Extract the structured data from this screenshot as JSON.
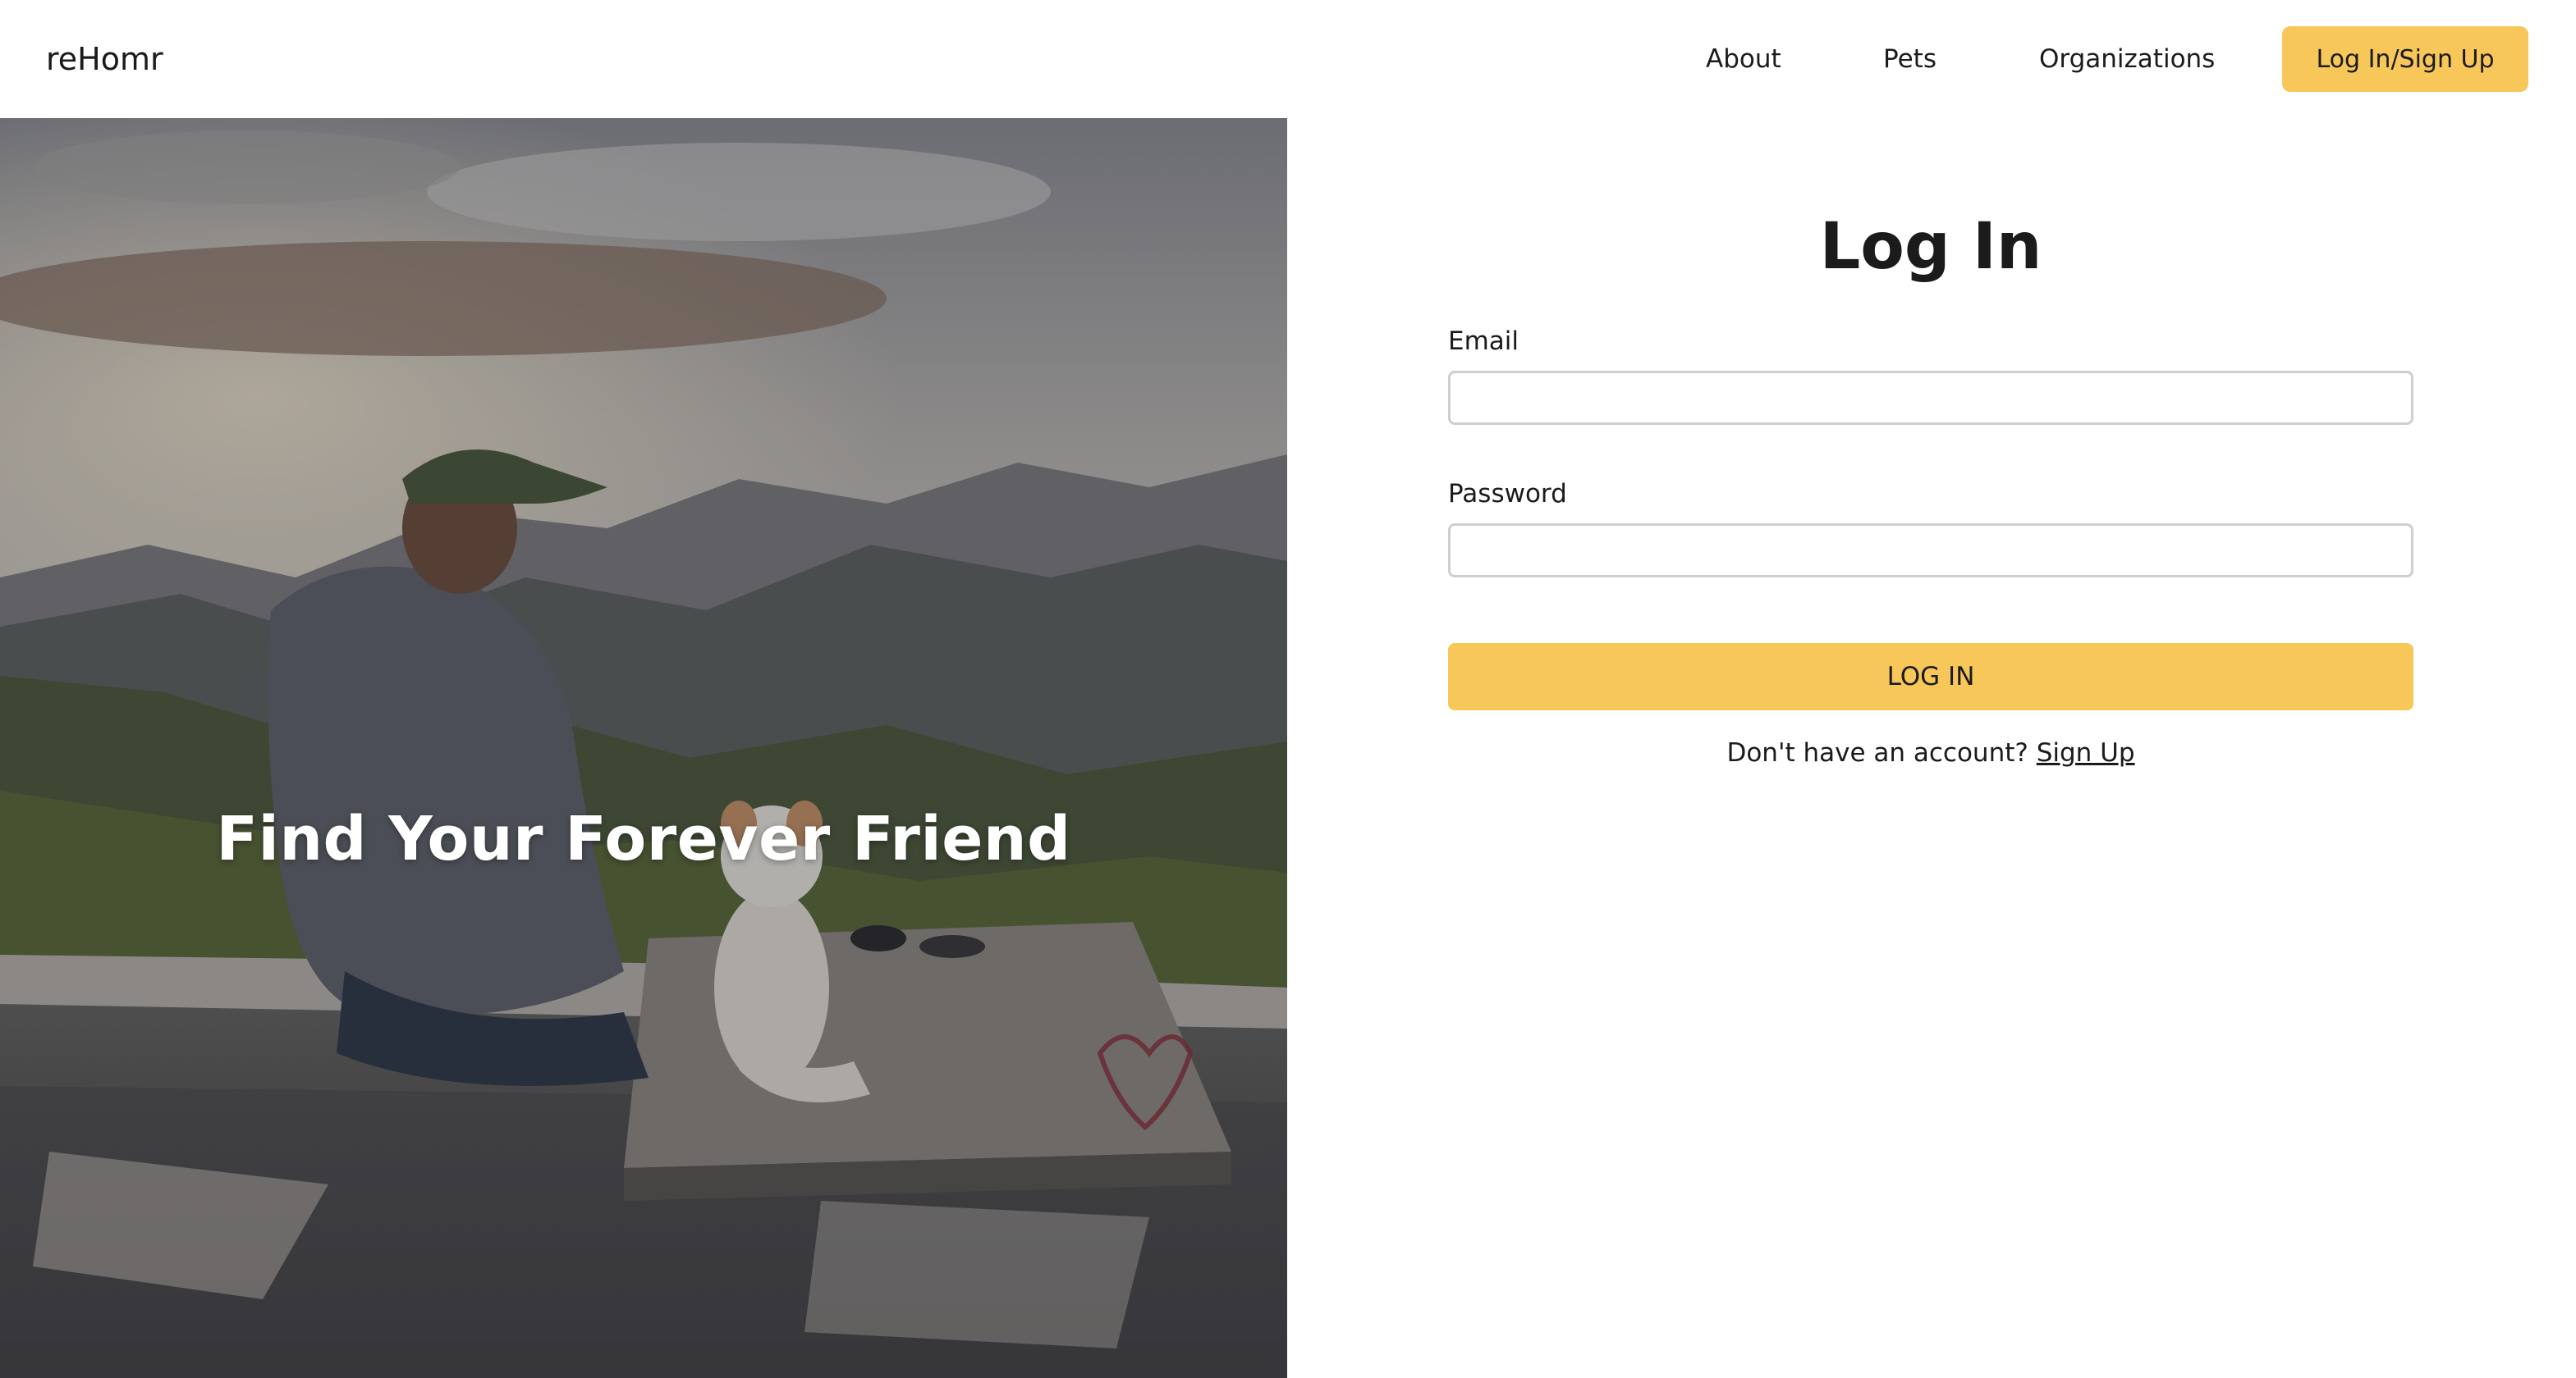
{
  "header": {
    "brand": "reHomr",
    "nav": {
      "about": "About",
      "pets": "Pets",
      "organizations": "Organizations",
      "cta": "Log In/Sign Up"
    }
  },
  "hero": {
    "title": "Find Your Forever Friend"
  },
  "login": {
    "title": "Log In",
    "email_label": "Email",
    "email_value": "",
    "password_label": "Password",
    "password_value": "",
    "submit_label": "LOG IN",
    "signup_prompt": "Don't have an account?",
    "signup_link": "Sign Up"
  },
  "colors": {
    "accent": "#f8c75a",
    "text": "#1b1b1b",
    "input_border": "#cfcfcf"
  }
}
